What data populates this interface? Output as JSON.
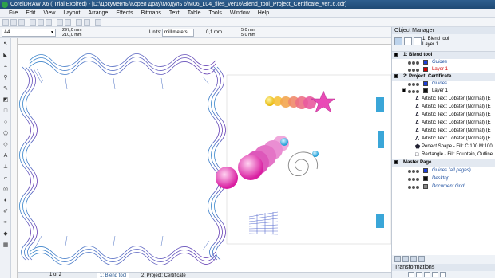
{
  "window": {
    "title": "CorelDRAW X6 ( Trial Expired) - [D:\\Документы\\Корел Драу\\Модуль 6\\M06_L04_files_ver16\\Blend_tool_Project_Certificate_ver16.cdr]"
  },
  "menu": [
    "File",
    "Edit",
    "View",
    "Layout",
    "Arrange",
    "Effects",
    "Bitmaps",
    "Text",
    "Table",
    "Tools",
    "Window",
    "Help"
  ],
  "propbar": {
    "page_size": "A4",
    "width": "297,0 mm",
    "height": "210,0 mm",
    "units_label": "Units:",
    "units_value": "millimeters",
    "nudge": "0,1 mm",
    "dup_x": "5,0 mm",
    "dup_y": "5,0 mm"
  },
  "object_manager": {
    "title": "Object Manager",
    "current_page": "1: Blend tool",
    "current_layer": "Layer 1",
    "rows": [
      {
        "type": "section",
        "label": "1: Blend tool"
      },
      {
        "type": "layer",
        "label": "Guides",
        "style": "blue",
        "swatch": "#1d3fd8"
      },
      {
        "type": "layer",
        "label": "Layer 1",
        "style": "red",
        "swatch": "#d00000"
      },
      {
        "type": "section",
        "label": "2: Project: Certificate"
      },
      {
        "type": "layer",
        "label": "Guides",
        "style": "blue",
        "swatch": "#1d3fd8"
      },
      {
        "type": "layer",
        "label": "Layer 1",
        "style": "normal",
        "swatch": "#111111"
      },
      {
        "type": "object",
        "label": "Artistic Text: Lobster (Normal) (E"
      },
      {
        "type": "object",
        "label": "Artistic Text: Lobster (Normal) (E"
      },
      {
        "type": "object",
        "label": "Artistic Text: Lobster (Normal) (E"
      },
      {
        "type": "object",
        "label": "Artistic Text: Lobster (Normal) (E"
      },
      {
        "type": "object",
        "label": "Artistic Text: Lobster (Normal) (E"
      },
      {
        "type": "object",
        "label": "Artistic Text: Lobster (Normal) (E"
      },
      {
        "type": "object",
        "label": "Perfect Shape - Fill: C:100 M:100"
      },
      {
        "type": "object",
        "label": "Rectangle - Fill: Fountain, Outline"
      },
      {
        "type": "section",
        "label": "Master Page"
      },
      {
        "type": "layer",
        "label": "Guides (all pages)",
        "style": "blue",
        "swatch": "#1d3fd8"
      },
      {
        "type": "layer",
        "label": "Desktop",
        "style": "blue",
        "swatch": "#111111"
      },
      {
        "type": "layer",
        "label": "Document Grid",
        "style": "blue",
        "swatch": "#888888"
      }
    ]
  },
  "transformations": {
    "title": "Transformations"
  },
  "doc_tabs": {
    "pager": "1 of 2",
    "tab1": "1: Blend tool",
    "tab2": "2: Project: Certificate"
  },
  "colors": {
    "frame_blue": "#3d7fc6",
    "frame_purple": "#6a47b8",
    "accent_pink": "#e64ec0",
    "ball_yellow": "#f2d21a",
    "ball_cyan": "#38b4e0"
  }
}
